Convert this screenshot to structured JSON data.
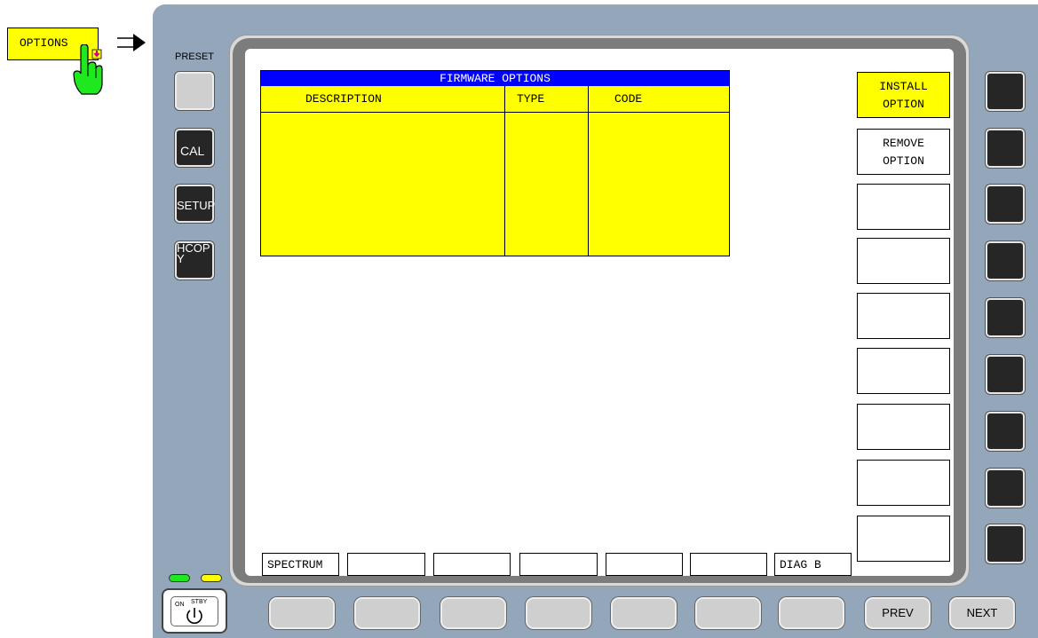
{
  "annotation": {
    "options_label": "OPTIONS"
  },
  "left_keys": {
    "preset_label": "PRESET",
    "cal_label": "CAL",
    "setup_label": "SETUP",
    "hcopy_label": "HCOP\nY"
  },
  "table": {
    "title": "FIRMWARE OPTIONS",
    "columns": [
      "DESCRIPTION",
      "TYPE",
      "CODE"
    ],
    "rows": []
  },
  "softkeys": [
    "INSTALL\nOPTION",
    "REMOVE\nOPTION",
    "",
    "",
    "",
    "",
    "",
    "",
    ""
  ],
  "tabs": [
    "SPECTRUM",
    "",
    "",
    "",
    "",
    "",
    "DIAG B"
  ],
  "bottom_keys": {
    "prev_label": "PREV",
    "next_label": "NEXT"
  },
  "power": {
    "on_label": "ON",
    "stby_label": "STBY"
  },
  "colors": {
    "highlight": "#ffff00",
    "title_bar": "#0000ff",
    "instrument": "#93a6ba",
    "led_on": "#1fe81f",
    "led_stby": "#ffff00",
    "hand": "#1fe81f"
  },
  "icons": {
    "hand": "pointing-hand-icon",
    "arrow": "right-arrow-icon",
    "power": "power-symbol-icon"
  }
}
